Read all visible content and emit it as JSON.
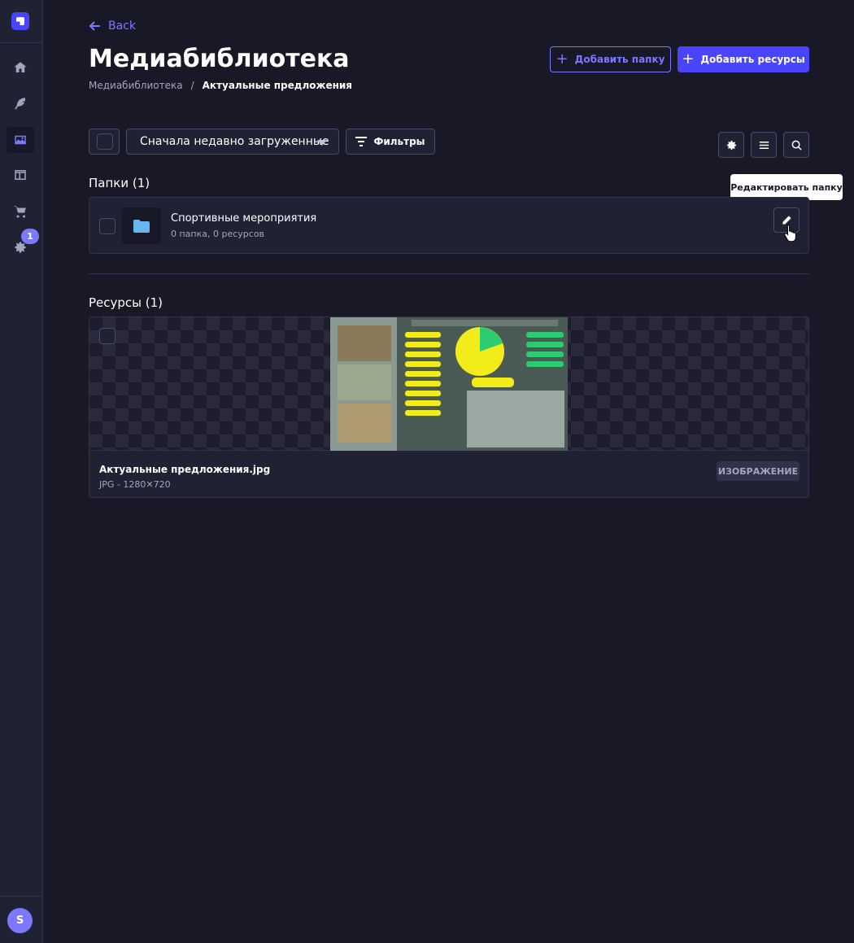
{
  "sidebar": {
    "items": [
      {
        "name": "home",
        "icon": "house-icon"
      },
      {
        "name": "content-types-builder",
        "icon": "feather-icon"
      },
      {
        "name": "media-library",
        "icon": "image-icon",
        "active": true
      },
      {
        "name": "content-manager",
        "icon": "layout-icon"
      },
      {
        "name": "marketplace",
        "icon": "cart-icon"
      },
      {
        "name": "settings",
        "icon": "gear-icon",
        "badge": "1"
      }
    ],
    "user_initial": "S"
  },
  "header": {
    "back_label": "Back",
    "title": "Медиабиблиотека",
    "breadcrumb": {
      "root": "Медиабиблиотека",
      "separator": "/",
      "current": "Актуальные предложения"
    },
    "add_folder_label": "Добавить папку",
    "add_assets_label": "Добавить ресурсы"
  },
  "toolbar": {
    "sort_value": "Сначала недавно загруженные",
    "filters_label": "Фильтры",
    "icons": [
      "gear-icon",
      "list-icon",
      "search-icon"
    ]
  },
  "tooltip": "Редактировать папку",
  "folders": {
    "heading": "Папки (1)",
    "items": [
      {
        "name": "Спортивные мероприятия",
        "meta": "0 папка, 0 ресурсов"
      }
    ]
  },
  "assets": {
    "heading": "Ресурсы (1)",
    "items": [
      {
        "name": "Актуальные предложения.jpg",
        "meta": "JPG - 1280✕720",
        "type": "ИЗОБРАЖЕНИЕ"
      }
    ]
  },
  "colors": {
    "primary": "#4945ff",
    "accent": "#7b79ff",
    "background": "#181826",
    "surface": "#212134"
  }
}
